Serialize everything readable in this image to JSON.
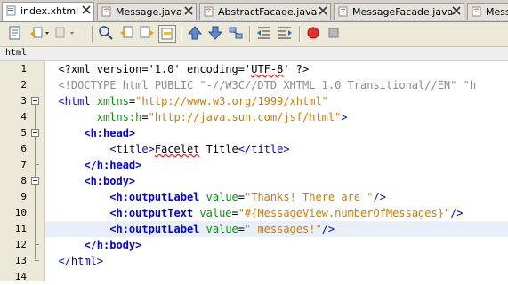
{
  "tabs": [
    {
      "label": "index.xhtml",
      "icon": "xhtml-file-icon",
      "active": true
    },
    {
      "label": "Message.java",
      "icon": "java-file-icon",
      "active": false
    },
    {
      "label": "AbstractFacade.java",
      "icon": "java-file-icon",
      "active": false
    },
    {
      "label": "MessageFacade.java",
      "icon": "java-file-icon",
      "active": false
    },
    {
      "label": "Messa",
      "icon": "java-file-icon",
      "active": false
    }
  ],
  "toolbar": {
    "buttons": [
      "source-view-icon",
      "back-history-icon",
      "forward-history-icon",
      "find-icon",
      "find-previous-icon",
      "find-next-icon",
      "toggle-highlight-icon",
      "previous-bookmark-icon",
      "next-bookmark-icon",
      "toggle-bookmark-icon",
      "shift-left-icon",
      "shift-right-icon",
      "start-macro-icon",
      "stop-macro-icon"
    ]
  },
  "breadcrumb": {
    "label": "html"
  },
  "editor": {
    "line_numbers": [
      "1",
      "2",
      "3",
      "4",
      "5",
      "6",
      "7",
      "8",
      "9",
      "10",
      "11",
      "12",
      "13",
      "14"
    ],
    "highlighted_line": "11",
    "lines": {
      "l1": {
        "pi": "<?xml version='1.0' encoding='",
        "enc": "UTF-8",
        "pi_end": "' ?>"
      },
      "l2": {
        "doctype": "<!DOCTYPE html PUBLIC \"-//W3C//DTD XHTML 1.0 Transitional//EN\" \"h"
      },
      "l3": {
        "tag_open": "<html",
        "attr": "xmlns",
        "eq": "=",
        "value": "\"http://www.w3.org/1999/xhtml\""
      },
      "l4": {
        "attr": "xmlns:h",
        "eq": "=",
        "value": "\"http://java.sun.com/jsf/html\"",
        "tag_close": ">"
      },
      "l5": {
        "tag": "<h:head>"
      },
      "l6": {
        "tag_open": "<title>",
        "text": "Facelet",
        "text2": " Title",
        "tag_close": "</title>"
      },
      "l7": {
        "tag": "</h:head>"
      },
      "l8": {
        "tag": "<h:body>"
      },
      "l9": {
        "tag_open": "<h:outputLabel",
        "attr": "value",
        "eq": "=",
        "value": "\"Thanks! There are \"",
        "tag_close": "/>"
      },
      "l10": {
        "tag_open": "<h:outputText",
        "attr": "value",
        "eq": "=",
        "value": "\"#{MessageView.numberOfMessages}\"",
        "tag_close": "/>"
      },
      "l11": {
        "tag_open": "<h:outputLabel",
        "attr": "value",
        "eq": "=",
        "value": "\" messages!\"",
        "tag_close": "/>"
      },
      "l12": {
        "tag": "</h:body>"
      },
      "l13": {
        "tag": "</html>"
      },
      "l14": {}
    }
  },
  "colors": {
    "tag": "#0000e6",
    "attr": "#009900",
    "string": "#ce7b00",
    "doctype": "#8a8a8a",
    "current_line": "#e9eff8"
  }
}
